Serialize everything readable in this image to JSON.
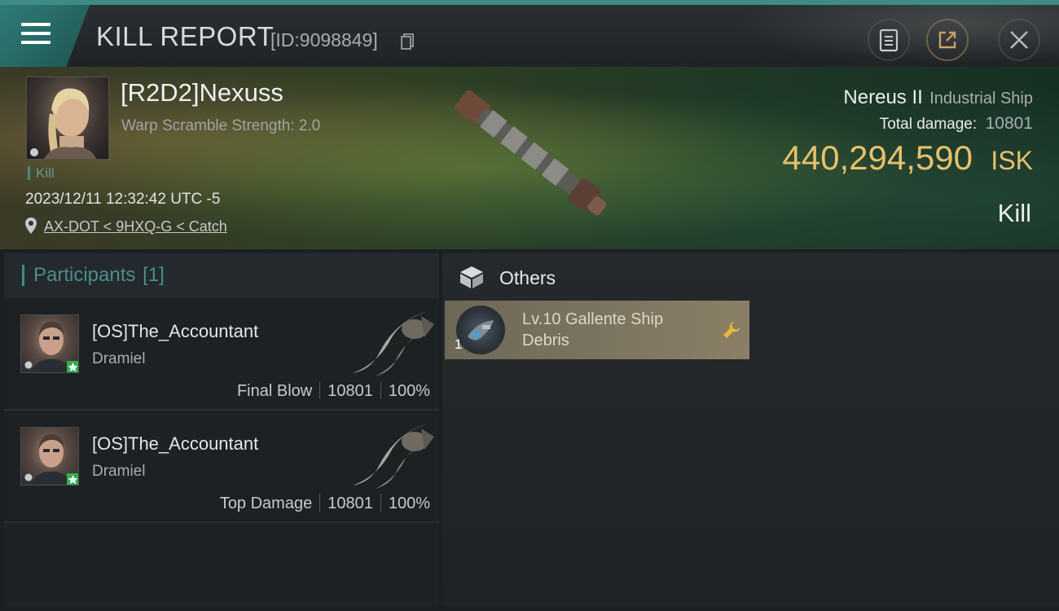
{
  "header": {
    "title": "KILL REPORT",
    "report_id": "[ID:9098849]"
  },
  "victim": {
    "name": "[R2D2]Nexuss",
    "warp_scramble": "Warp Scramble Strength: 2.0",
    "tag": "Kill",
    "timestamp": "2023/12/11 12:32:42 UTC -5",
    "location": "AX-DOT < 9HXQ-G < Catch",
    "ship_name": "Nereus II",
    "ship_class": "Industrial Ship",
    "total_damage_label": "Total damage:",
    "total_damage": "10801",
    "isk_value": "440,294,590",
    "isk_unit": "ISK",
    "result": "Kill"
  },
  "participants": {
    "title": "Participants",
    "count": "[1]",
    "items": [
      {
        "name": "[OS]The_Accountant",
        "ship": "Dramiel",
        "role": "Final Blow",
        "damage": "10801",
        "percent": "100%"
      },
      {
        "name": "[OS]The_Accountant",
        "ship": "Dramiel",
        "role": "Top Damage",
        "damage": "10801",
        "percent": "100%"
      }
    ]
  },
  "others": {
    "title": "Others",
    "items": [
      {
        "name": "Lv.10 Gallente Ship Debris",
        "quantity": "1"
      }
    ]
  },
  "colors": {
    "accent_teal": "#3f8c86",
    "isk_gold": "#e8c06c",
    "loot_bg": "#7c7560"
  },
  "icons": {
    "menu": "hamburger-icon",
    "copy": "copy-icon",
    "notes": "clipboard-icon",
    "share": "share-icon",
    "close": "close-icon",
    "location": "map-pin-icon",
    "others": "cube-icon",
    "repair": "wrench-icon"
  }
}
